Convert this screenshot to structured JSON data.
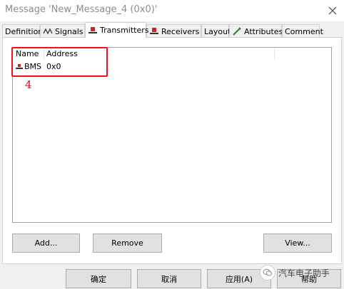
{
  "window": {
    "title": "Message 'New_Message_4 (0x0)'"
  },
  "tabs": [
    {
      "label": "Definition",
      "icon": null
    },
    {
      "label": "Signals",
      "icon": "signals-icon"
    },
    {
      "label": "Transmitters",
      "icon": "transmitter-icon",
      "active": true
    },
    {
      "label": "Receivers",
      "icon": "receiver-icon"
    },
    {
      "label": "Layout",
      "icon": null
    },
    {
      "label": "Attributes",
      "icon": "attributes-icon"
    },
    {
      "label": "Comment",
      "icon": null
    }
  ],
  "list": {
    "columns": [
      "Name",
      "Address"
    ],
    "rows": [
      {
        "name": "BMS",
        "address": "0x0",
        "icon": "ecu-node-icon"
      }
    ]
  },
  "annotation": {
    "label": "4",
    "color": "#e8141b"
  },
  "panel_buttons": {
    "add": "Add...",
    "remove": "Remove",
    "view": "View..."
  },
  "dialog_buttons": {
    "ok": "确定",
    "cancel": "取消",
    "apply": "应用(A)",
    "help": "帮助"
  },
  "watermark": {
    "text": "汽车电子助手"
  }
}
